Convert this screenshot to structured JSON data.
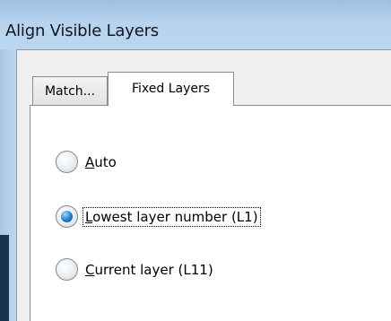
{
  "window": {
    "title": "Align Visible Layers"
  },
  "tabs": [
    {
      "label": "Match...",
      "selected": false
    },
    {
      "label": "Fixed Layers",
      "selected": true
    }
  ],
  "options": [
    {
      "mnemonic": "A",
      "rest": "uto",
      "checked": false
    },
    {
      "mnemonic": "L",
      "rest": "owest layer number (L1)",
      "checked": true
    },
    {
      "mnemonic": "C",
      "rest": "urrent layer (L11)",
      "checked": false
    }
  ],
  "colors": {
    "titlebar": "#b7d3ee",
    "dialog_bg": "#f0f0f0",
    "panel_bg": "#ffffff",
    "radio_checked": "#2a8fd8"
  }
}
